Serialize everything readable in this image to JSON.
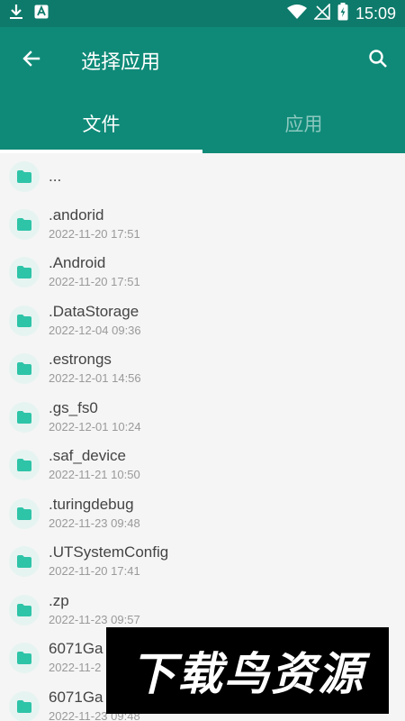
{
  "status_bar": {
    "time": "15:09",
    "left_icons": [
      "download-icon",
      "a-badge-icon"
    ],
    "right_icons": [
      "wifi-icon",
      "no-signal-icon",
      "battery-charging-icon"
    ]
  },
  "app_bar": {
    "title": "选择应用",
    "back_icon": "arrow-left-icon",
    "search_icon": "search-icon",
    "background": "#0f8a78"
  },
  "tabs": [
    {
      "label": "文件",
      "active": true
    },
    {
      "label": "应用",
      "active": false
    }
  ],
  "files": [
    {
      "name": "...",
      "date": ""
    },
    {
      "name": ".andorid",
      "date": "2022-11-20 17:51"
    },
    {
      "name": ".Android",
      "date": "2022-11-20 17:51"
    },
    {
      "name": ".DataStorage",
      "date": "2022-12-04 09:36"
    },
    {
      "name": ".estrongs",
      "date": "2022-12-01 14:56"
    },
    {
      "name": ".gs_fs0",
      "date": "2022-12-01 10:24"
    },
    {
      "name": ".saf_device",
      "date": "2022-11-21 10:50"
    },
    {
      "name": ".turingdebug",
      "date": "2022-11-23 09:48"
    },
    {
      "name": ".UTSystemConfig",
      "date": "2022-11-20 17:41"
    },
    {
      "name": ".zp",
      "date": "2022-11-23 09:57"
    },
    {
      "name": "6071Ga",
      "date": "2022-11-2"
    },
    {
      "name": "6071Ga",
      "date": "2022-11-23 09:48"
    }
  ],
  "watermark": {
    "text": "下载鸟资源"
  },
  "colors": {
    "accent": "#0f8a78",
    "folder_icon": "#2ec4a8",
    "folder_bg": "#e6f4f1"
  }
}
